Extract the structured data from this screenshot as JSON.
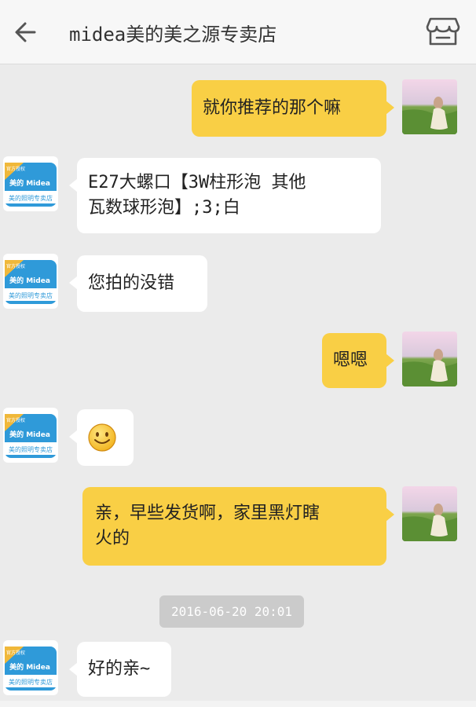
{
  "header": {
    "title": "midea美的美之源专卖店",
    "back_icon": "arrow-left-icon",
    "store_icon": "store-icon"
  },
  "avatars": {
    "shop_badge": "官方授权",
    "shop_brand": "美的 Midea",
    "shop_caption": "美的照明专卖店"
  },
  "messages": [
    {
      "side": "me",
      "text": "就你推荐的那个嘛"
    },
    {
      "side": "shop",
      "line1": "E27大螺口【3W柱形泡 其他",
      "line2": "瓦数球形泡】;3;白"
    },
    {
      "side": "shop",
      "text": "您拍的没错"
    },
    {
      "side": "me",
      "text": "嗯嗯"
    },
    {
      "side": "shop",
      "emoji": "smile-emoji"
    },
    {
      "side": "me",
      "line1": "亲，早些发货啊，家里黑灯瞎",
      "line2": "火的"
    },
    {
      "side": "shop",
      "text": "好的亲~"
    }
  ],
  "timestamp": "2016-06-20 20:01",
  "colors": {
    "me_bubble": "#f9cf45",
    "shop_bubble": "#ffffff",
    "background": "#ebebeb"
  }
}
